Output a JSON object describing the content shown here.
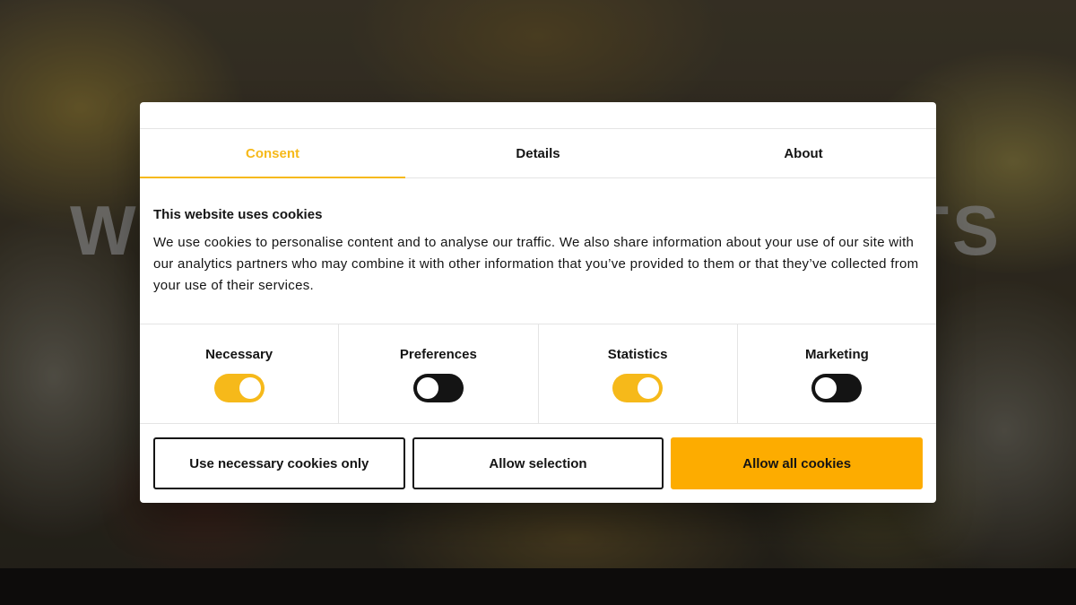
{
  "background": {
    "headline_left": "W",
    "headline_right": "TS"
  },
  "tabs": [
    {
      "label": "Consent",
      "active": true
    },
    {
      "label": "Details",
      "active": false
    },
    {
      "label": "About",
      "active": false
    }
  ],
  "consent": {
    "title": "This website uses cookies",
    "text": "We use cookies to personalise content and to analyse our traffic. We also share information about your use of our site with our analytics partners who may combine it with other information that you’ve provided to them or that they’ve collected from your use of their services."
  },
  "toggles": [
    {
      "label": "Necessary",
      "on": true
    },
    {
      "label": "Preferences",
      "on": false
    },
    {
      "label": "Statistics",
      "on": true
    },
    {
      "label": "Marketing",
      "on": false
    }
  ],
  "buttons": {
    "necessary_only": "Use necessary cookies only",
    "allow_selection": "Allow selection",
    "allow_all": "Allow all cookies"
  },
  "colors": {
    "accent": "#f6b91a",
    "primary_button": "#fdac00",
    "text": "#141414"
  }
}
